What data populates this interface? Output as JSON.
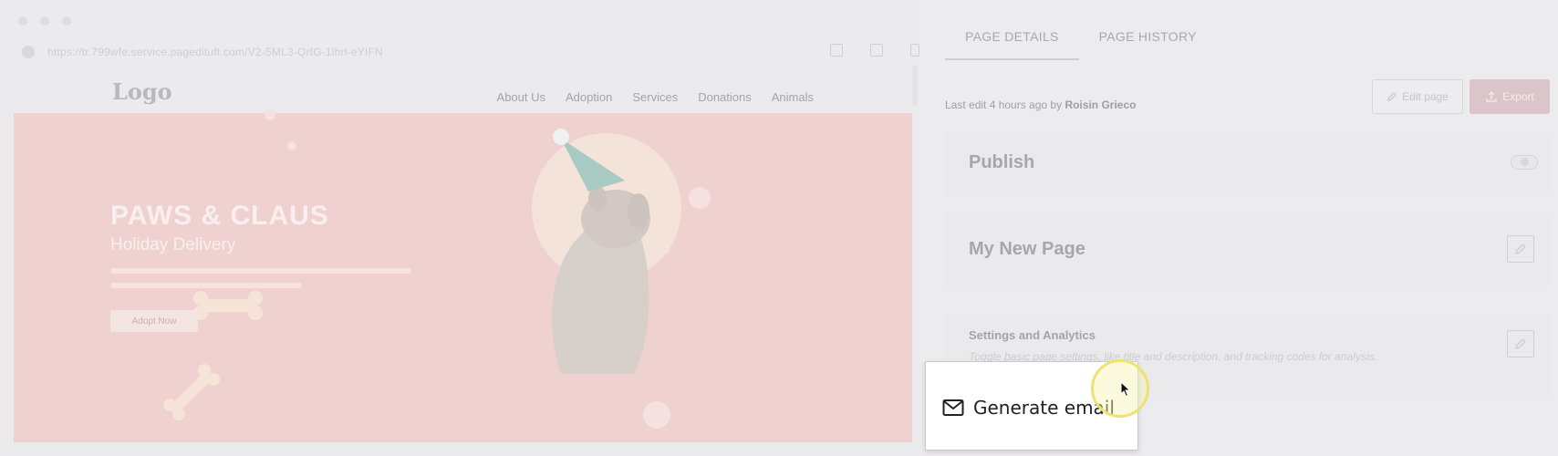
{
  "browser": {
    "url": "https://tr.799wfe.service.pagedituft.com/V2-5ML3-QrfG-1lhrl-eYIFN"
  },
  "site": {
    "logo": "Logo",
    "nav": [
      "About Us",
      "Adoption",
      "Services",
      "Donations",
      "Animals"
    ],
    "hero_title": "PAWS & CLAUS",
    "hero_subtitle": "Holiday Delivery",
    "hero_button": "Adopt Now"
  },
  "panel": {
    "tabs": [
      "PAGE DETAILS",
      "PAGE HISTORY"
    ],
    "active_tab": "PAGE DETAILS",
    "last_edit_prefix": "Last edit 4 hours ago by",
    "last_edit_user": "Roisin Grieco",
    "edit_button": "Edit page",
    "export_button": "Export",
    "publish_label": "Publish",
    "page_name": "My New Page",
    "settings_title": "Settings and Analytics",
    "settings_desc": "Toggle basic page settings, like title and description, and tracking codes for analysis."
  },
  "popup": {
    "label": "Generate email"
  },
  "colors": {
    "hero_background": "#efd1d0",
    "export_accent": "#dcc4cb",
    "cursor_highlight": "#efe272"
  }
}
